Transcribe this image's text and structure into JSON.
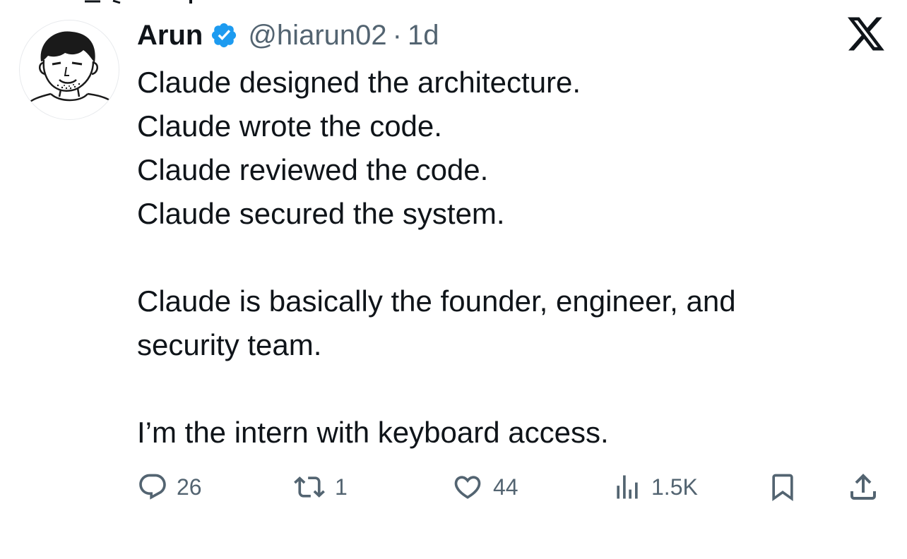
{
  "tweet": {
    "author": {
      "name": "Arun",
      "handle": "@hiarun02",
      "verified": true,
      "verified_color": "#1d9bf0"
    },
    "separator": "·",
    "time": "1d",
    "text_lines": [
      "Claude designed the architecture.",
      "Claude wrote the code.",
      "Claude reviewed the code.",
      "Claude secured the system.",
      "",
      "Claude is basically the founder, engineer, and",
      "security team.",
      "",
      "I’m the intern with keyboard access."
    ],
    "stats": {
      "replies": "26",
      "reposts": "1",
      "likes": "44",
      "views": "1.5K"
    }
  },
  "colors": {
    "text": "#0f1419",
    "secondary": "#536471",
    "accent": "#1d9bf0"
  },
  "icons": {
    "avatar": "avatar-sketch",
    "verified": "verified-badge-icon",
    "logo": "x-logo-icon",
    "reply": "reply-icon",
    "repost": "repost-icon",
    "like": "heart-icon",
    "views": "views-icon",
    "bookmark": "bookmark-icon",
    "share": "share-icon"
  }
}
